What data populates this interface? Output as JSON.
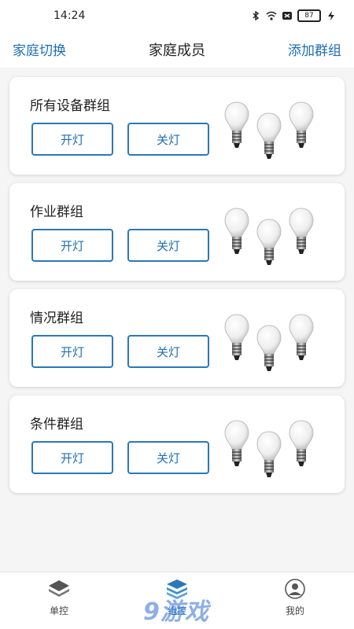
{
  "status_bar": {
    "time": "14:24",
    "battery": "87",
    "icons": [
      "bluetooth-icon",
      "wifi-icon",
      "sim-off-icon",
      "battery-icon",
      "charging-icon"
    ]
  },
  "header": {
    "left": "家庭切换",
    "title": "家庭成员",
    "right": "添加群组"
  },
  "groups": [
    {
      "name": "所有设备群组",
      "on": "开灯",
      "off": "关灯"
    },
    {
      "name": "作业群组",
      "on": "开灯",
      "off": "关灯"
    },
    {
      "name": "情况群组",
      "on": "开灯",
      "off": "关灯"
    },
    {
      "name": "条件群组",
      "on": "开灯",
      "off": "关灯"
    }
  ],
  "nav": [
    {
      "label": "单控",
      "icon": "stack-icon"
    },
    {
      "label": "组控",
      "icon": "layers-icon",
      "active": true
    },
    {
      "label": "我的",
      "icon": "user-icon"
    }
  ],
  "colors": {
    "accent": "#1f6fb2",
    "button_border": "#2a78b8",
    "background": "#f5f5f5"
  },
  "watermark": "9游戏"
}
